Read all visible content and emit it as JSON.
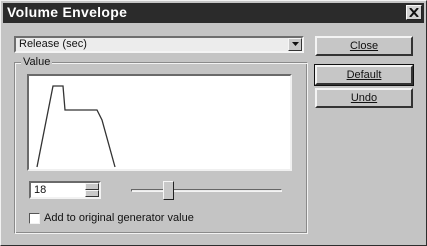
{
  "window": {
    "title": "Volume Envelope"
  },
  "controls": {
    "parameter_select": {
      "value": "Release (sec)"
    },
    "value_group_label": "Value",
    "value_input": "18",
    "add_to_original_label": "Add to original generator value"
  },
  "buttons": {
    "close_label": "Close",
    "default_label": "Default",
    "undo_label": "Undo"
  },
  "slider": {
    "position_fraction": 0.22
  },
  "colors": {
    "titlebar": "#2b2b2b",
    "face": "#c4c4c4",
    "graph_line": "#333333"
  },
  "icons": {
    "close": "close-icon",
    "dropdown": "chevron-down-icon"
  }
}
